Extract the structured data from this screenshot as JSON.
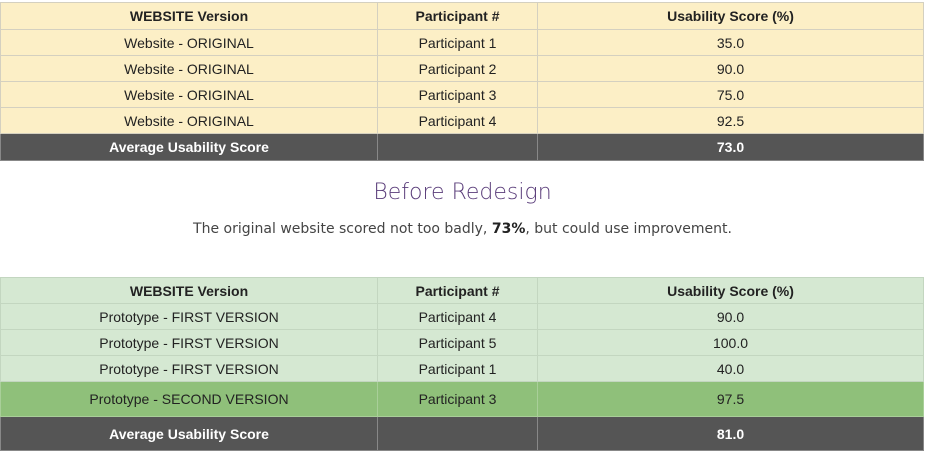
{
  "columns": [
    "WEBSITE Version",
    "Participant #",
    "Usability Score (%)"
  ],
  "table_original": {
    "rows": [
      [
        "Website - ORIGINAL",
        "Participant 1",
        "35.0"
      ],
      [
        "Website - ORIGINAL",
        "Participant 2",
        "90.0"
      ],
      [
        "Website - ORIGINAL",
        "Participant 3",
        "75.0"
      ],
      [
        "Website - ORIGINAL",
        "Participant 4",
        "92.5"
      ]
    ],
    "average": {
      "label": "Average Usability Score",
      "participant": "",
      "value": "73.0"
    }
  },
  "section": {
    "title": "Before Redesign",
    "text_before": "The original website scored not too badly, ",
    "text_bold": "73%",
    "text_after": ", but could use improvement."
  },
  "table_prototype": {
    "rows": [
      [
        "Prototype - FIRST VERSION",
        "Participant 4",
        "90.0"
      ],
      [
        "Prototype - FIRST VERSION",
        "Participant 5",
        "100.0"
      ],
      [
        "Prototype - FIRST VERSION",
        "Participant 1",
        "40.0"
      ],
      [
        "Prototype - SECOND VERSION",
        "Participant 3",
        "97.5"
      ]
    ],
    "average": {
      "label": "Average Usability Score",
      "participant": "",
      "value": "81.0"
    }
  },
  "colors": {
    "original_bg": "#fcefc6",
    "prototype_bg": "#d5e8d2",
    "second_version_bg": "#8fc07a",
    "average_bg": "#555555",
    "title_color": "#5a3d7a"
  }
}
